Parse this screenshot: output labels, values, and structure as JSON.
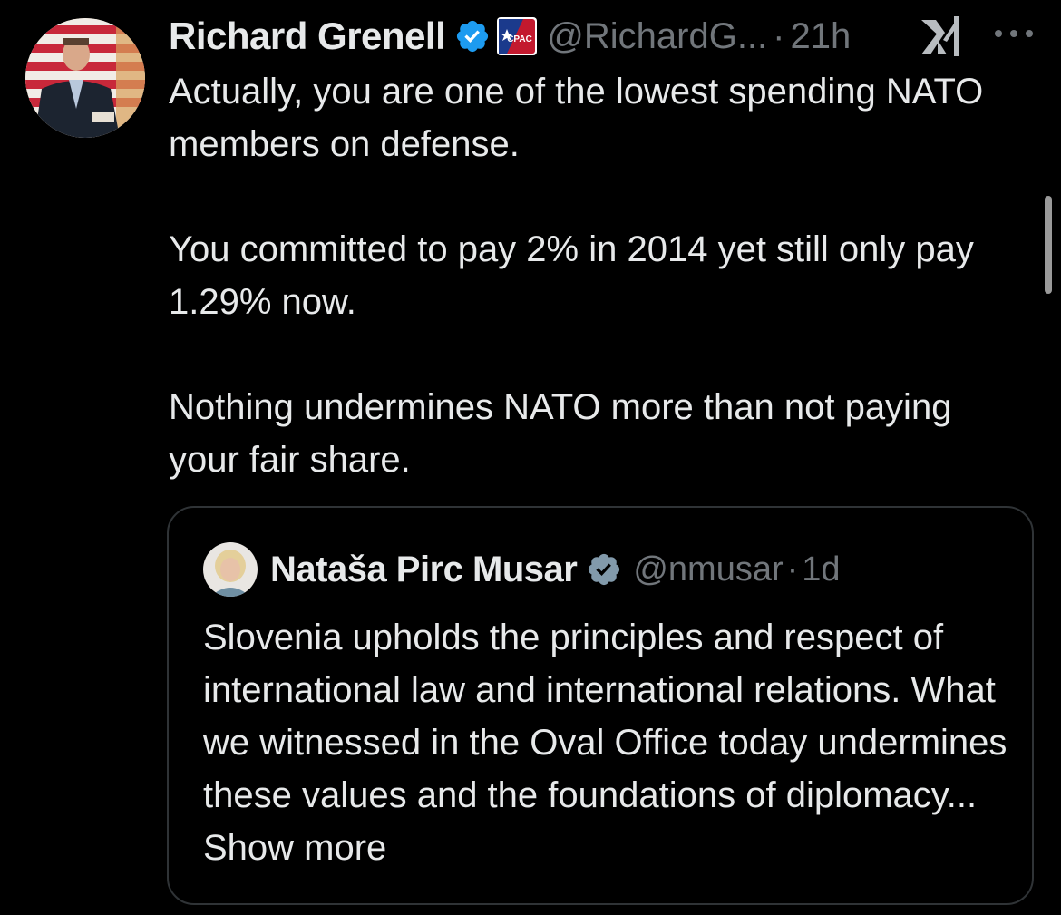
{
  "colors": {
    "background": "#000000",
    "text_primary": "#e7e9ea",
    "text_secondary": "#71767b",
    "verified_blue": "#1d9bf0",
    "border": "#2f3336"
  },
  "tweet": {
    "author": {
      "display_name": "Richard Grenell",
      "handle": "@RichardG...",
      "verified_icon": "verified-badge-icon",
      "affiliation_icon": "cpac-badge-icon"
    },
    "separator": "·",
    "time": "21h",
    "paragraphs": [
      "Actually, you are one of the lowest spending NATO members on defense.",
      "You committed to pay 2% in 2014 yet still only pay 1.29% now.",
      "Nothing undermines NATO more than not paying your fair share."
    ],
    "grok_icon": "grok-icon",
    "more_icon": "more-options-icon"
  },
  "quoted_tweet": {
    "author": {
      "display_name": "Nataša Pirc Musar",
      "handle": "@nmusar",
      "verified_icon": "verified-badge-icon"
    },
    "separator": "·",
    "time": "1d",
    "text": "Slovenia upholds the principles and respect of international law and international relations. What we witnessed in the Oval Office today undermines these values and the foundations of diplomacy...",
    "show_more_label": "Show more"
  }
}
